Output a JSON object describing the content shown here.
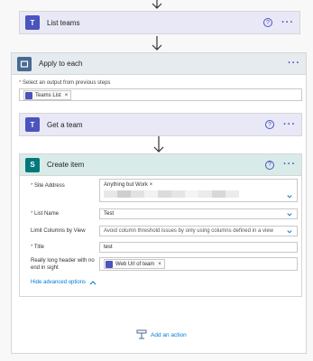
{
  "cards": {
    "list_teams": {
      "title": "List teams"
    },
    "apply_to_each": {
      "title": "Apply to each",
      "select_label": "Select an output from previous steps",
      "token_label": "Teams List"
    },
    "get_team": {
      "title": "Get a team"
    },
    "create_item": {
      "title": "Create item",
      "site_address": {
        "label": "Site Address",
        "value": "Anything but Work"
      },
      "list_name": {
        "label": "List Name",
        "value": "Test"
      },
      "limit_columns": {
        "label": "Limit Columns by View",
        "value": "Avoid column threshold issues by only using columns defined in a view"
      },
      "title_field": {
        "label": "Title",
        "value": "test"
      },
      "long_header": {
        "label": "Really long header with no end in sight",
        "token": "Web Url of team"
      },
      "hide_advanced": "Hide advanced options"
    }
  },
  "add_action": "Add an action",
  "icons": {
    "teams": "teams-icon",
    "loop": "loop-icon",
    "sharepoint": "sharepoint-icon"
  },
  "colors": {
    "teams": "#4b53bc",
    "sharepoint": "#03787c",
    "loop": "#486991",
    "link": "#0078d4"
  }
}
